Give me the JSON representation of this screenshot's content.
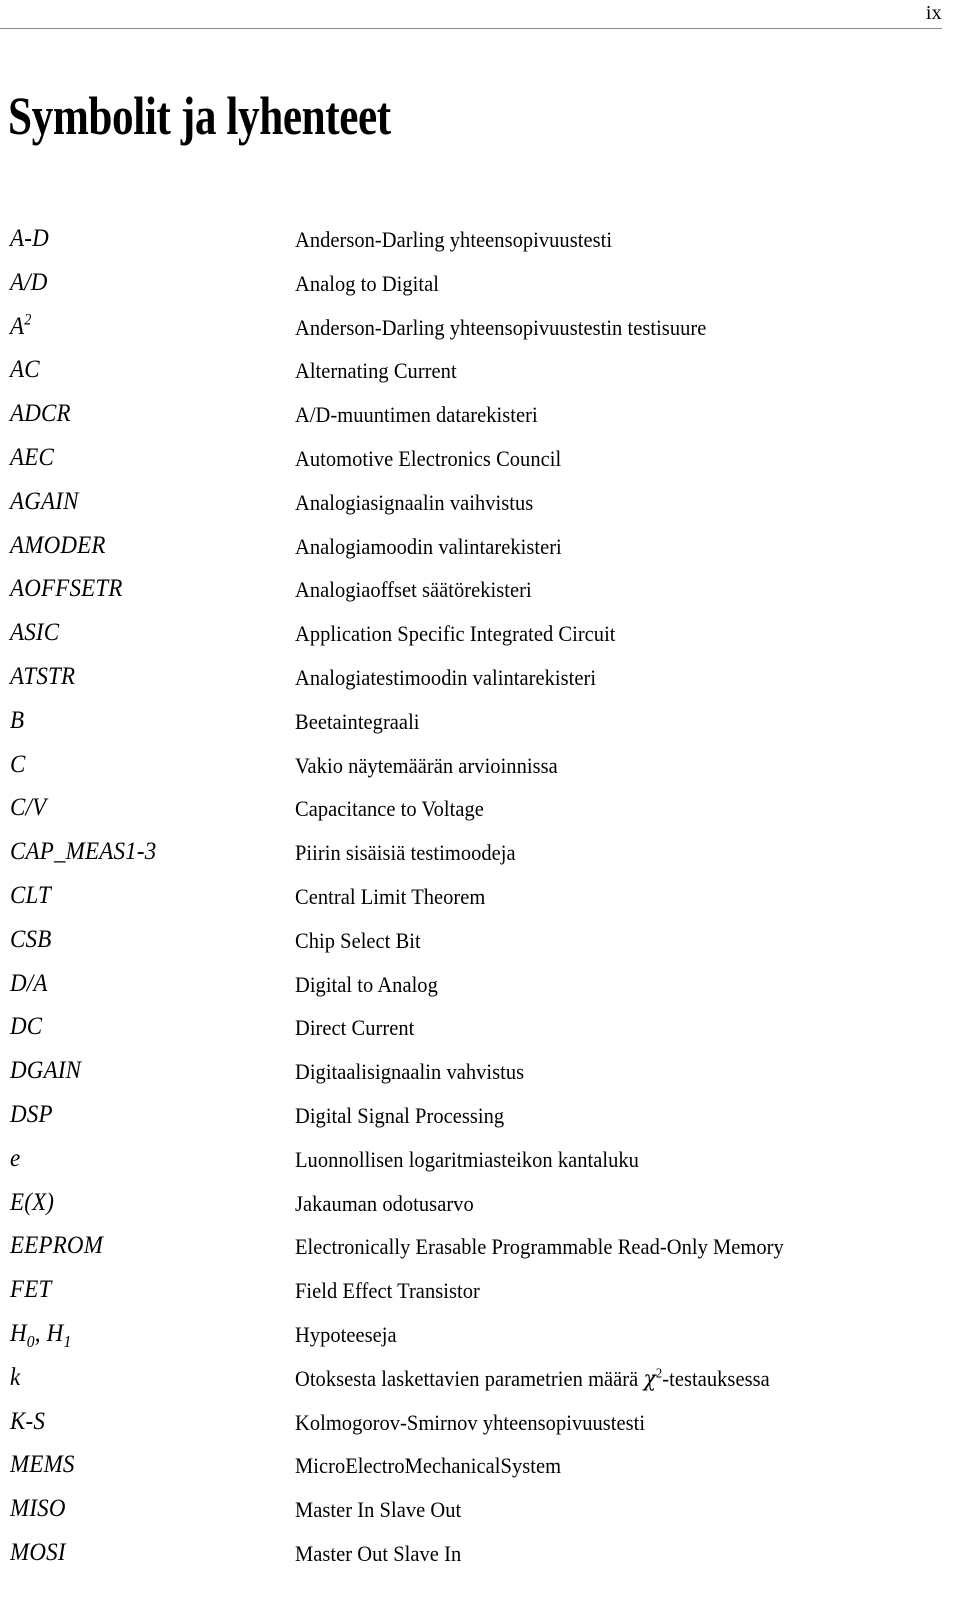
{
  "header": {
    "folio": "ix"
  },
  "title": "Symbolit ja lyhenteet",
  "glossary": {
    "rows": [
      {
        "symbol": "A-D",
        "definition": "Anderson-Darling yhteensopivuustesti"
      },
      {
        "symbol": "A/D",
        "definition": "Analog to Digital"
      },
      {
        "symbol": "A2",
        "symbol_base": "A",
        "symbol_sup": "2",
        "definition": "Anderson-Darling yhteensopivuustestin testisuure"
      },
      {
        "symbol": "AC",
        "definition": "Alternating Current"
      },
      {
        "symbol": "ADCR",
        "definition": "A/D-muuntimen datarekisteri"
      },
      {
        "symbol": "AEC",
        "definition": "Automotive Electronics Council"
      },
      {
        "symbol": "AGAIN",
        "definition": "Analogiasignaalin vaihvistus"
      },
      {
        "symbol": "AMODER",
        "definition": "Analogiamoodin valintarekisteri"
      },
      {
        "symbol": "AOFFSETR",
        "definition": "Analogiaoffset säätörekisteri"
      },
      {
        "symbol": "ASIC",
        "definition": "Application Specific Integrated Circuit"
      },
      {
        "symbol": "ATSTR",
        "definition": "Analogiatestimoodin valintarekisteri"
      },
      {
        "symbol": "B",
        "definition": "Beetaintegraali"
      },
      {
        "symbol": "C",
        "definition": "Vakio näytemäärän arvioinnissa"
      },
      {
        "symbol": "C/V",
        "definition": "Capacitance to Voltage"
      },
      {
        "symbol": "CAP_MEAS1-3",
        "definition": "Piirin sisäisiä testimoodeja"
      },
      {
        "symbol": "CLT",
        "definition": "Central Limit Theorem"
      },
      {
        "symbol": "CSB",
        "definition": "Chip Select Bit"
      },
      {
        "symbol": "D/A",
        "definition": "Digital to Analog"
      },
      {
        "symbol": "DC",
        "definition": "Direct Current"
      },
      {
        "symbol": "DGAIN",
        "definition": "Digitaalisignaalin vahvistus"
      },
      {
        "symbol": "DSP",
        "definition": "Digital Signal Processing"
      },
      {
        "symbol": "e",
        "definition": "Luonnollisen logaritmiasteikon kantaluku"
      },
      {
        "symbol": "E(X)",
        "definition": "Jakauman odotusarvo"
      },
      {
        "symbol": "EEPROM",
        "definition": "Electronically Erasable Programmable Read-Only Memory"
      },
      {
        "symbol": "FET",
        "definition": "Field Effect Transistor"
      },
      {
        "symbol": "H0, H1",
        "symbol_h_base": "H",
        "symbol_h_sub0": "0",
        "symbol_h_sub1": "1",
        "definition": "Hypoteeseja"
      },
      {
        "symbol": "k",
        "definition_pre": "Otoksesta laskettavien parametrien määrä ",
        "definition_chi": "χ",
        "definition_sup": "2",
        "definition_post": "-testauksessa",
        "definition": "Otoksesta laskettavien parametrien määrä χ2-testauksessa"
      },
      {
        "symbol": "K-S",
        "definition": "Kolmogorov-Smirnov yhteensopivuustesti"
      },
      {
        "symbol": "MEMS",
        "definition": "MicroElectroMechanicalSystem"
      },
      {
        "symbol": "MISO",
        "definition": "Master In Slave Out"
      },
      {
        "symbol": "MOSI",
        "definition": "Master Out Slave In"
      }
    ]
  }
}
